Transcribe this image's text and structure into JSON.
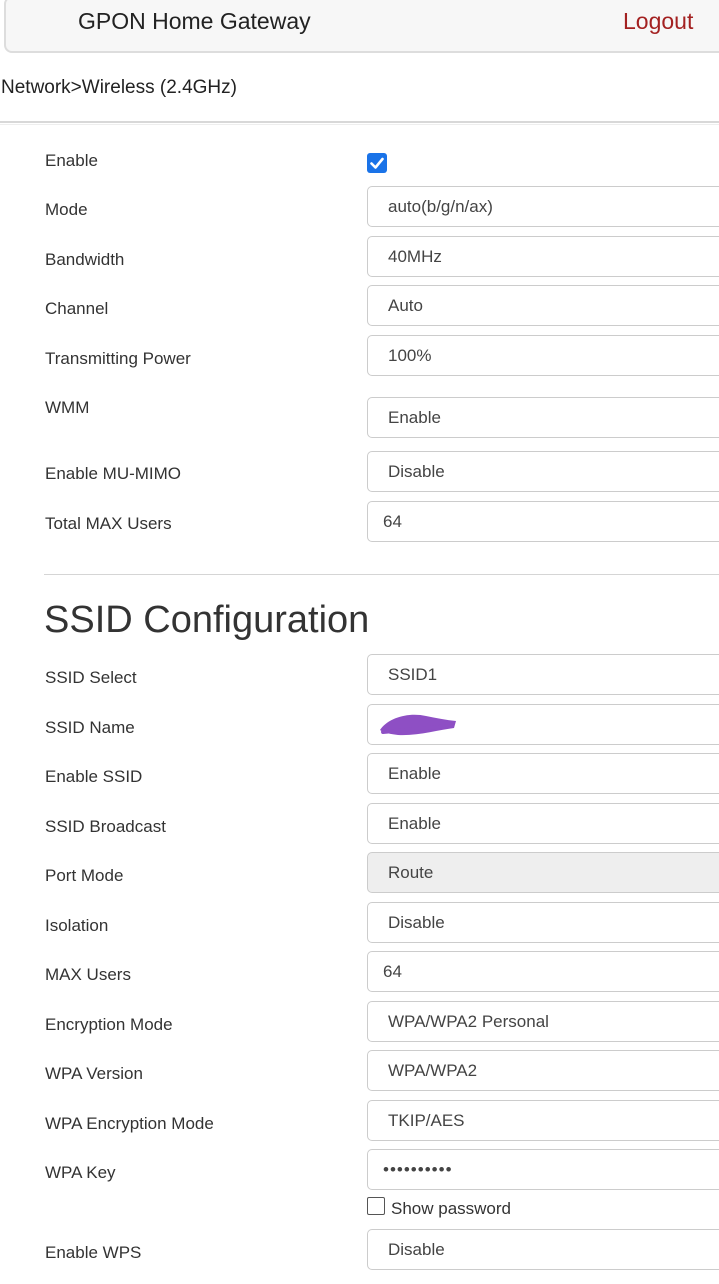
{
  "header": {
    "brand": "GPON Home Gateway",
    "logout_label": "Logout"
  },
  "breadcrumb": "Network>Wireless (2.4GHz)",
  "radio": {
    "enable_label": "Enable",
    "enable_checked": true,
    "mode_label": "Mode",
    "mode_value": "auto(b/g/n/ax)",
    "bandwidth_label": "Bandwidth",
    "bandwidth_value": "40MHz",
    "channel_label": "Channel",
    "channel_value": "Auto",
    "power_label": "Transmitting Power",
    "power_value": "100%",
    "wmm_label": "WMM",
    "wmm_value": "Enable",
    "mumimo_label": "Enable MU-MIMO",
    "mumimo_value": "Disable",
    "total_max_users_label": "Total MAX Users",
    "total_max_users_value": "64"
  },
  "ssid": {
    "title": "SSID Configuration",
    "select_label": "SSID Select",
    "select_value": "SSID1",
    "name_label": "SSID Name",
    "enable_label": "Enable SSID",
    "enable_value": "Enable",
    "broadcast_label": "SSID Broadcast",
    "broadcast_value": "Enable",
    "port_mode_label": "Port Mode",
    "port_mode_value": "Route",
    "isolation_label": "Isolation",
    "isolation_value": "Disable",
    "max_users_label": "MAX Users",
    "max_users_value": "64",
    "encryption_label": "Encryption Mode",
    "encryption_value": "WPA/WPA2 Personal",
    "wpa_version_label": "WPA Version",
    "wpa_version_value": "WPA/WPA2",
    "wpa_enc_label": "WPA Encryption Mode",
    "wpa_enc_value": "TKIP/AES",
    "wpa_key_label": "WPA Key",
    "wpa_key_value": "••••••••••",
    "show_password_label": "Show password",
    "wps_label": "Enable WPS",
    "wps_value": "Disable"
  },
  "colors": {
    "logout": "#a32121",
    "checkbox": "#1a73e8",
    "redaction": "#8e4fc4"
  }
}
